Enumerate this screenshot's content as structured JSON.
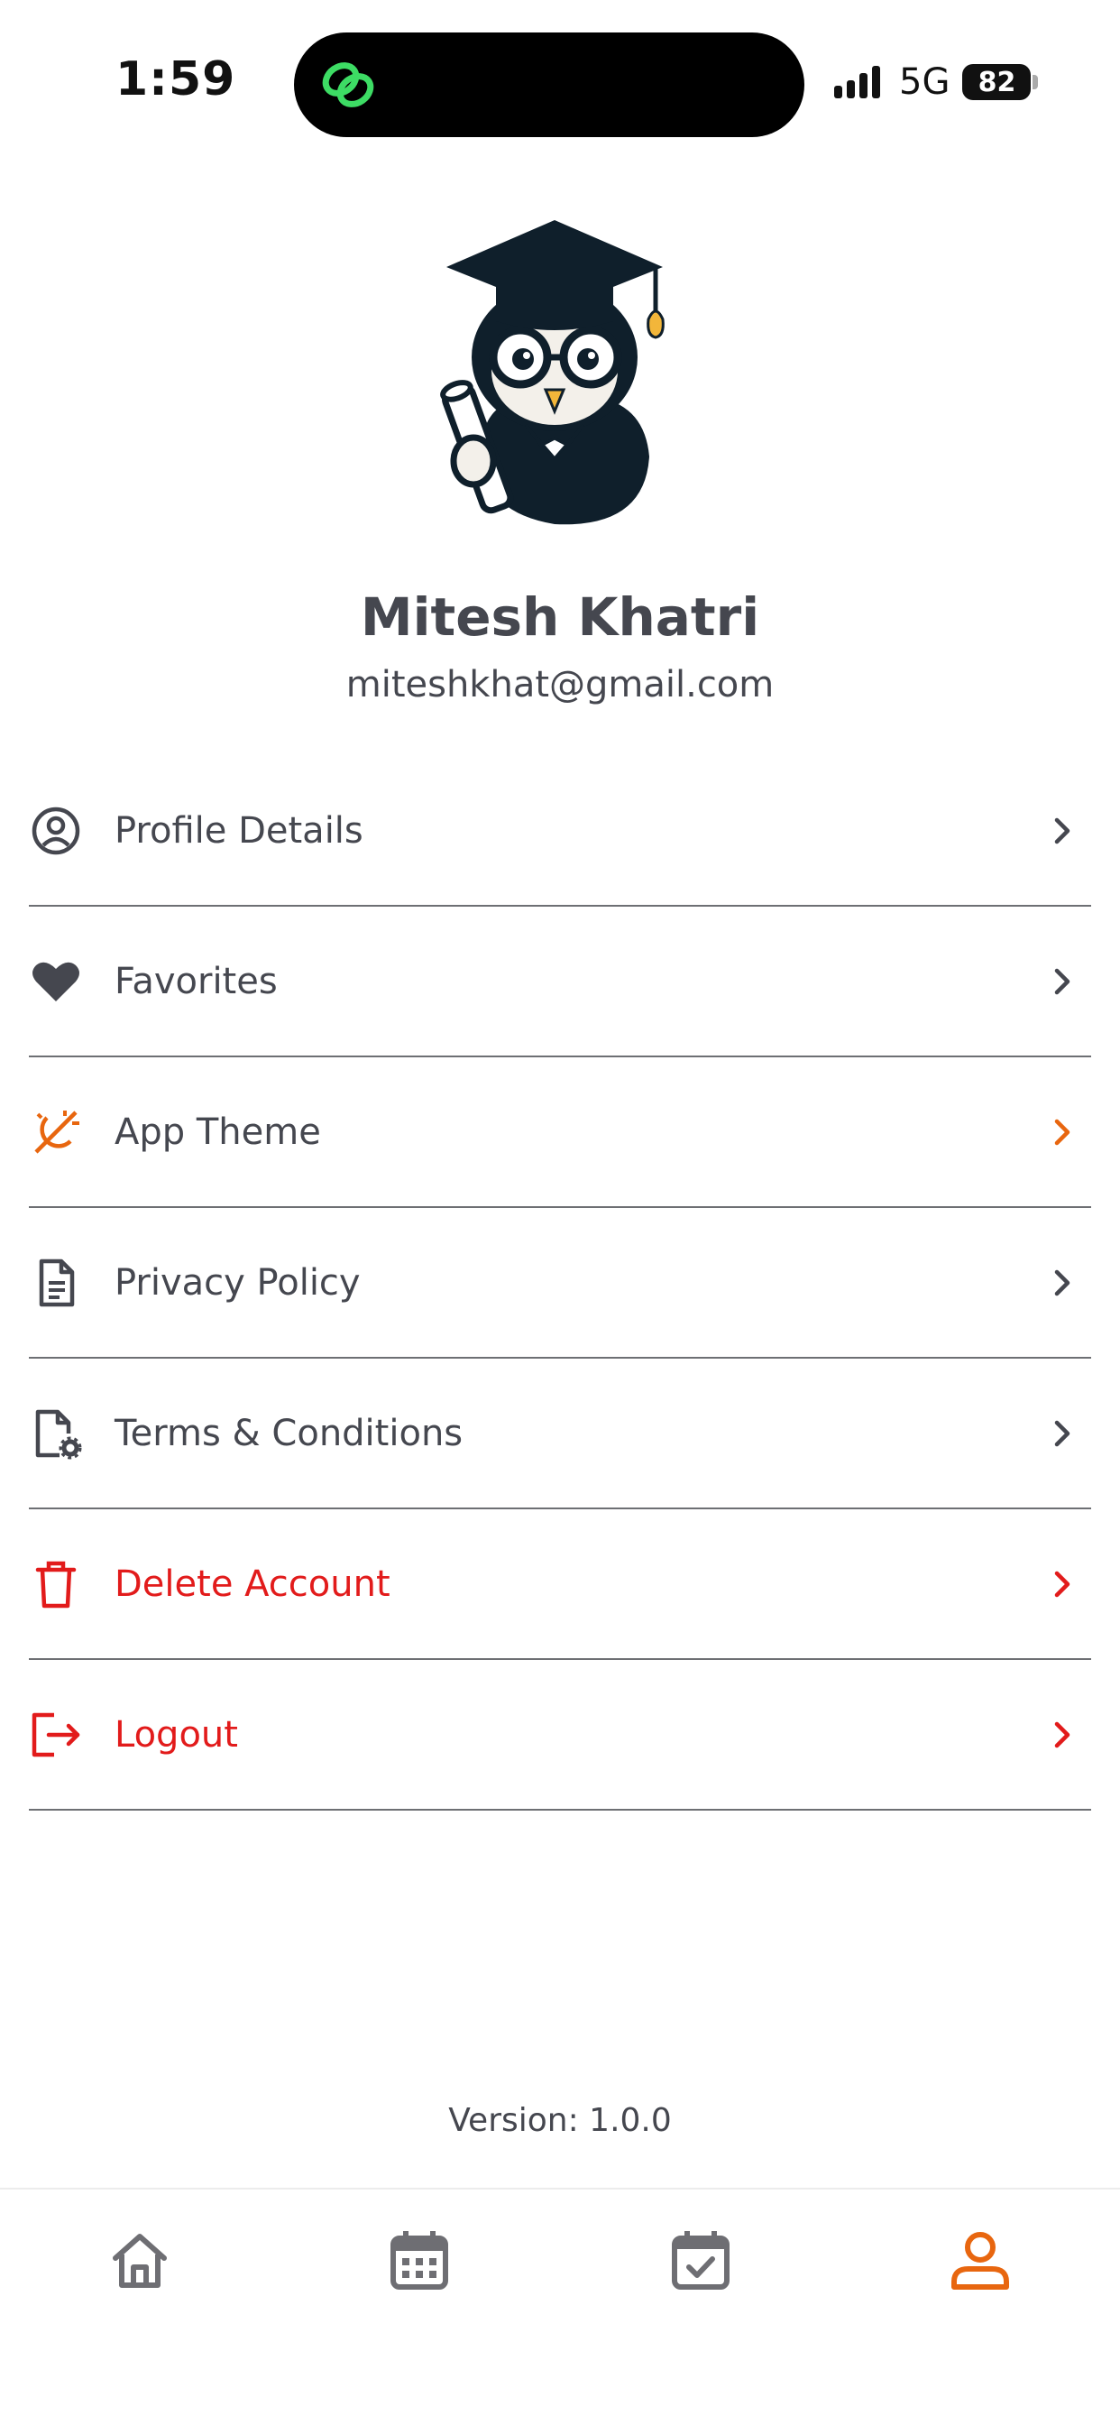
{
  "status_bar": {
    "time": "1:59",
    "network": "5G",
    "battery": "82"
  },
  "profile": {
    "name": "Mitesh Khatri",
    "email": "miteshkhat@gmail.com"
  },
  "menu": {
    "items": [
      {
        "label": "Profile Details",
        "icon": "user-circle-icon",
        "color": "#45474f"
      },
      {
        "label": "Favorites",
        "icon": "heart-icon",
        "color": "#45474f"
      },
      {
        "label": "App Theme",
        "icon": "theme-icon",
        "color": "#e8660f"
      },
      {
        "label": "Privacy Policy",
        "icon": "document-icon",
        "color": "#45474f"
      },
      {
        "label": "Terms & Conditions",
        "icon": "document-gear-icon",
        "color": "#45474f"
      },
      {
        "label": "Delete Account",
        "icon": "trash-icon",
        "color": "#e21b1b"
      },
      {
        "label": "Logout",
        "icon": "logout-icon",
        "color": "#e21b1b"
      }
    ]
  },
  "version": "Version: 1.0.0",
  "tabbar": {
    "tabs": [
      {
        "name": "home",
        "icon": "home-icon",
        "active": false
      },
      {
        "name": "calendar",
        "icon": "calendar-icon",
        "active": false
      },
      {
        "name": "tasks",
        "icon": "calendar-check-icon",
        "active": false
      },
      {
        "name": "profile",
        "icon": "user-icon",
        "active": true
      }
    ]
  },
  "colors": {
    "accent": "#e8660f",
    "danger": "#e21b1b",
    "text": "#45474f",
    "icon_gray": "#6e6e73"
  }
}
